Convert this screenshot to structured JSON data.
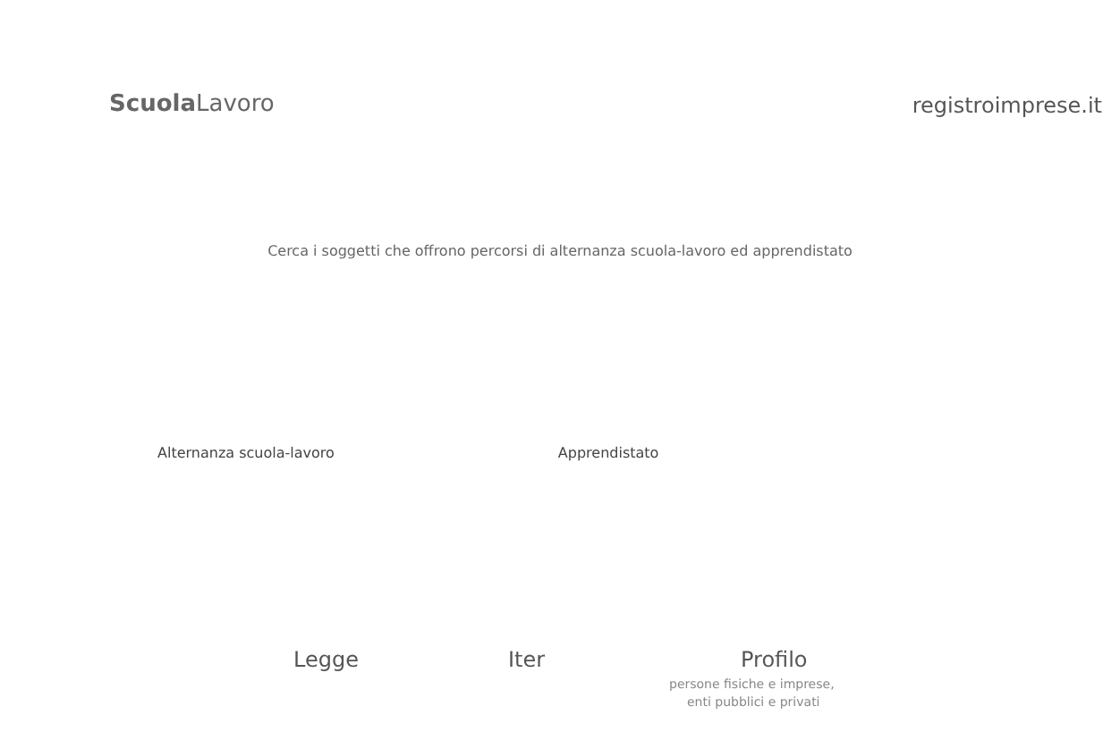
{
  "header": {
    "logo": "**Scuola**Lavoro",
    "link": "registroimprese.it"
  },
  "intro": "Cerca i soggetti che offrono percorsi di alternanza scuola-lavoro ed apprendistato",
  "categories": [
    "Alternanza scuola-lavoro",
    "Apprendistato"
  ],
  "footer_links": [
    {
      "label": "Legge"
    },
    {
      "label": "Iter"
    },
    {
      "label": "Profilo",
      "lines": [
        "persone fisiche e imprese,",
        "enti pubblici e privati"
      ]
    }
  ]
}
